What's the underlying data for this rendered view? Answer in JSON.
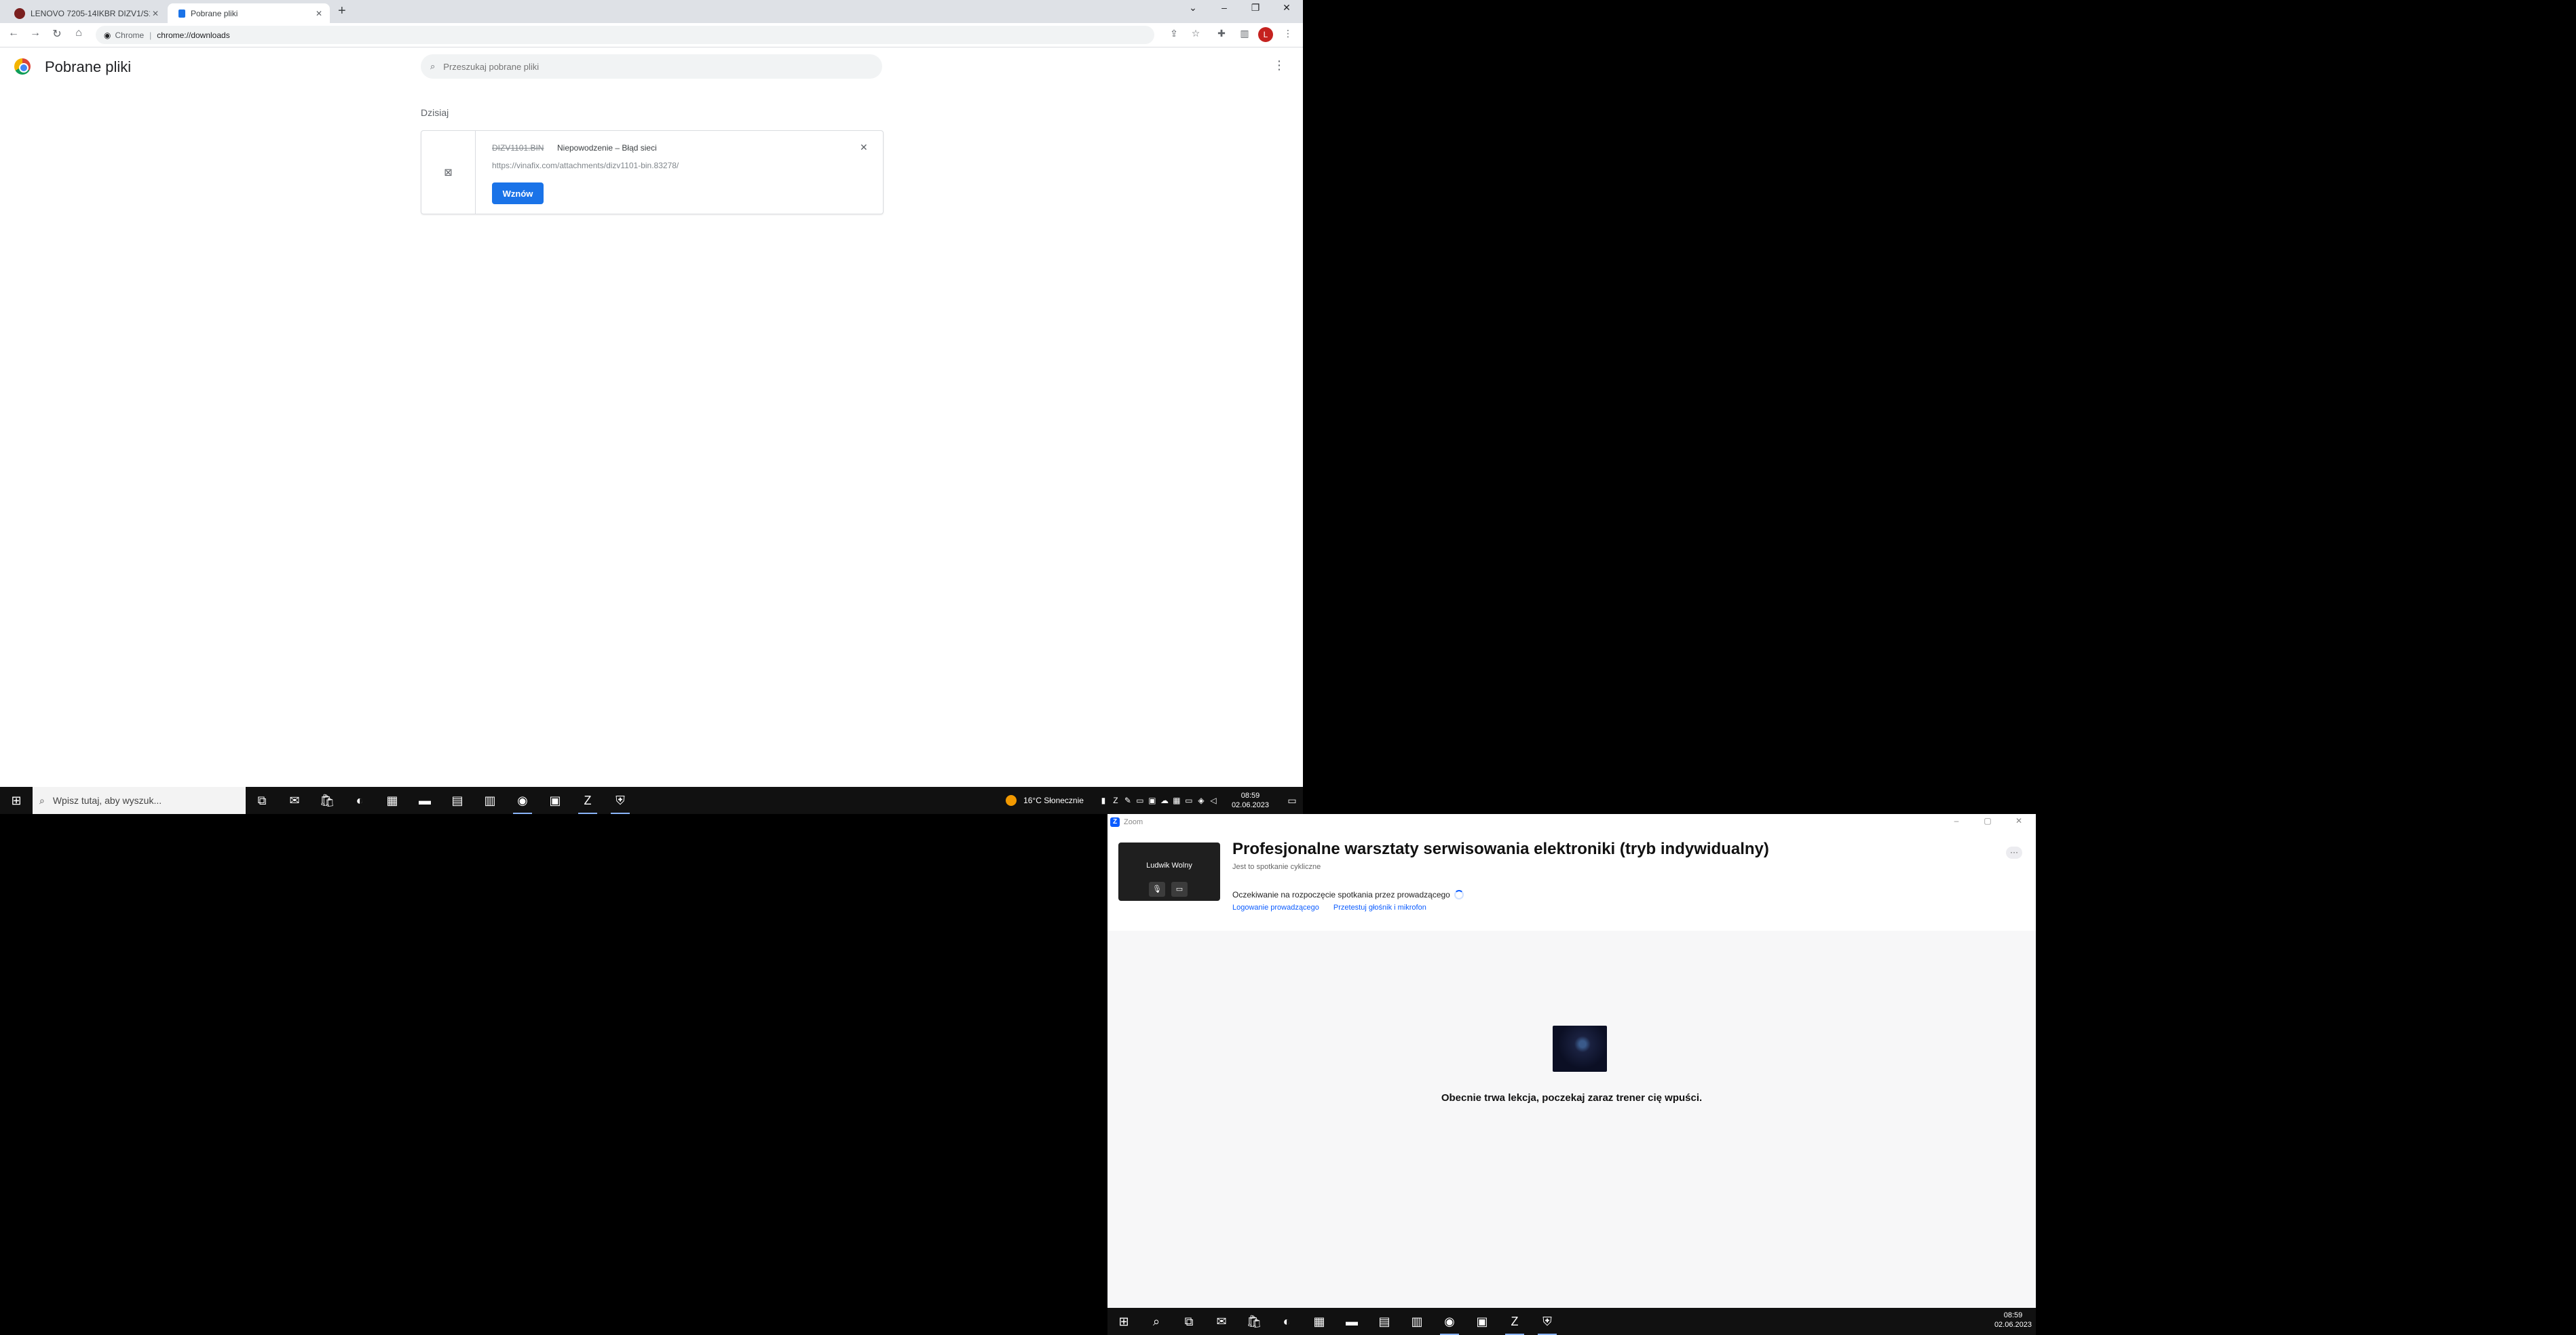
{
  "browser": {
    "tabs": [
      {
        "title": "LENOVO 7205-14IKBR DIZV1/S1..."
      },
      {
        "title": "Pobrane pliki"
      }
    ],
    "omnibox": {
      "chip": "Chrome",
      "url": "chrome://downloads"
    },
    "profile_initial": "L"
  },
  "downloads": {
    "title": "Pobrane pliki",
    "search_placeholder": "Przeszukaj pobrane pliki",
    "section": "Dzisiaj",
    "item": {
      "filename": "DIZV1101.BIN",
      "status": "Niepowodzenie – Błąd sieci",
      "url": "https://vinafix.com/attachments/dizv1101-bin.83278/",
      "retry_label": "Wznów"
    }
  },
  "taskbar1": {
    "search_text": "Wpisz tutaj, aby wyszuk...",
    "weather": "16°C  Słonecznie",
    "time": "08:59",
    "date": "02.06.2023"
  },
  "zoom": {
    "app_name": "Zoom",
    "participant_name": "Ludwik Wolny",
    "meeting_title": "Profesjonalne warsztaty serwisowania elektroniki (tryb indywidualny)",
    "meeting_subtitle": "Jest to spotkanie cykliczne",
    "waiting_text": "Oczekiwanie na rozpoczęcie spotkania przez prowadzącego",
    "link_login": "Logowanie prowadzącego",
    "link_test": "Przetestuj głośnik i mikrofon",
    "wait_message": "Obecnie trwa lekcja, poczekaj zaraz trener cię wpuści."
  },
  "taskbar2": {
    "time": "08:59",
    "date": "02.06.2023"
  },
  "colors": {
    "accent": "#1a73e8",
    "zoom_blue": "#0b5cff",
    "taskbar": "#111111"
  }
}
